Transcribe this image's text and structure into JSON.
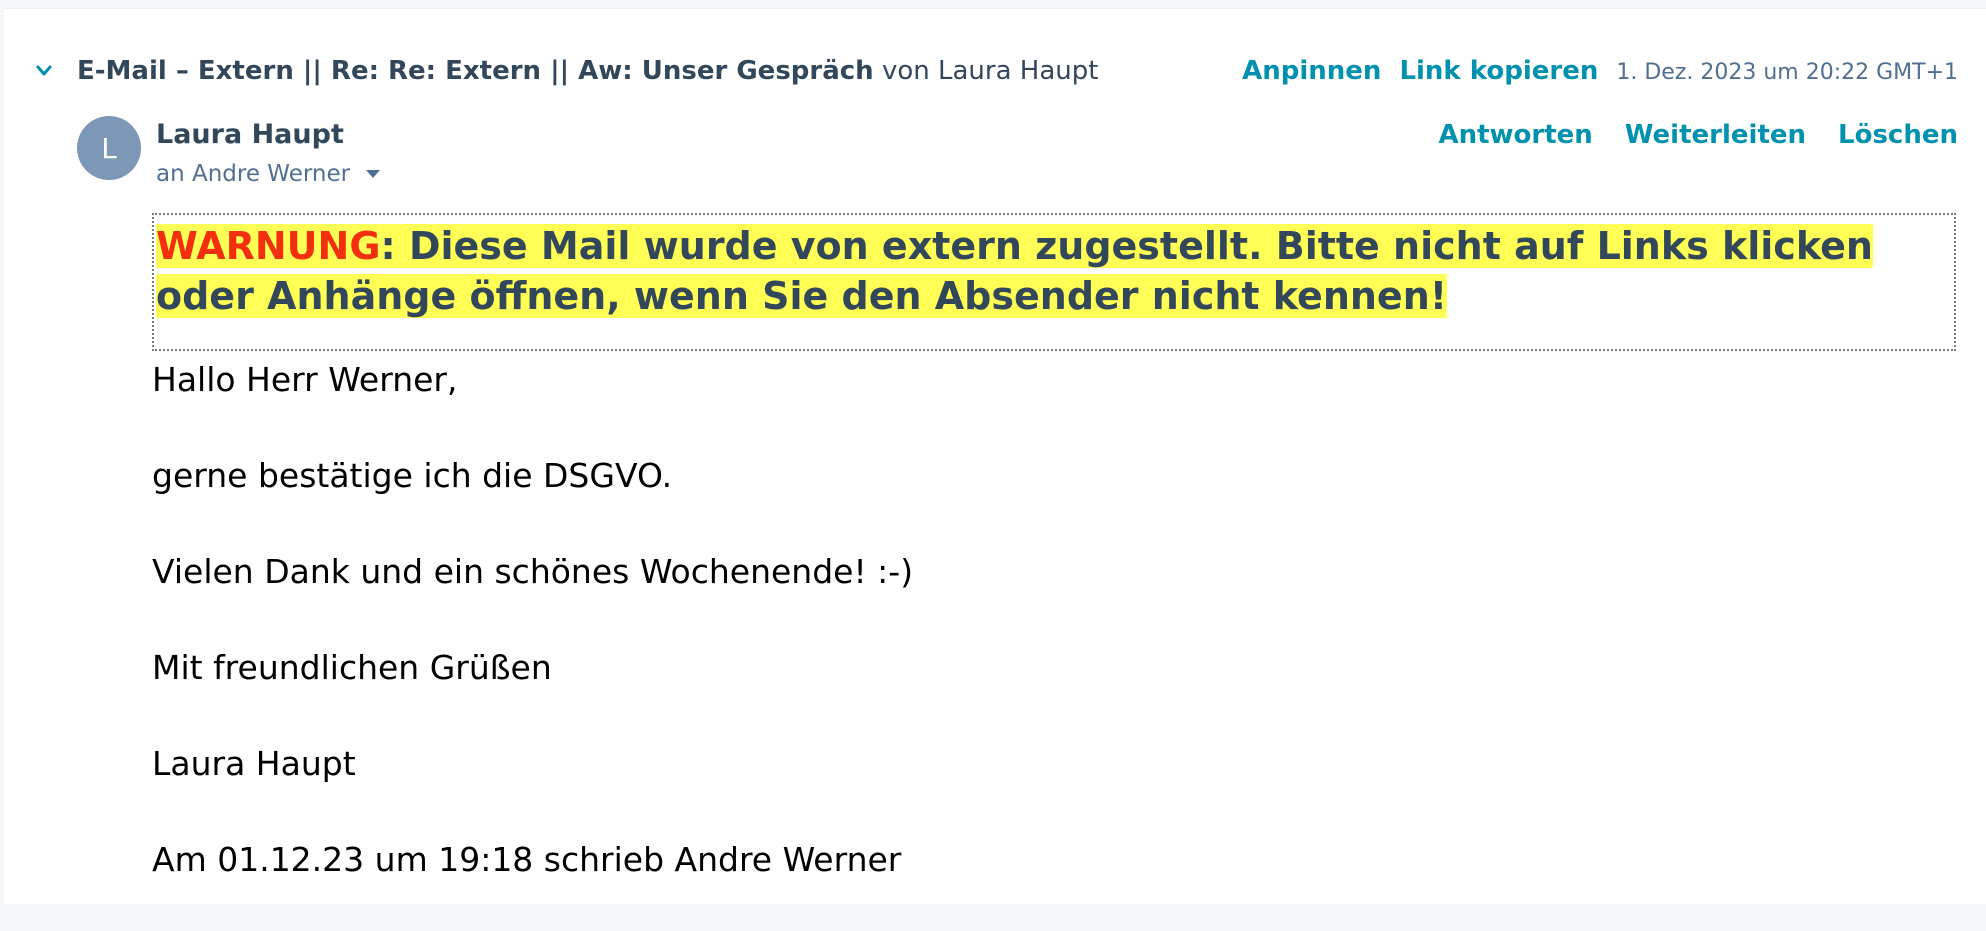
{
  "thread": {
    "subject": "E-Mail – Extern || Re: Re: Extern || Aw: Unser Gespräch",
    "from_label": " von Laura Haupt",
    "pin_label": "Anpinnen",
    "copy_link_label": "Link kopieren",
    "date": "1. Dez. 2023 um 20:22 GMT+1"
  },
  "message": {
    "avatar_initial": "L",
    "sender": "Laura Haupt",
    "recipient": "an Andre Werner",
    "reply_label": "Antworten",
    "forward_label": "Weiterleiten",
    "delete_label": "Löschen"
  },
  "warning": {
    "label": "WARNUNG",
    "text": ": Diese Mail wurde von extern zugestellt. Bitte nicht auf Links klicken oder Anhänge öffnen, wenn Sie den Absender nicht kennen!"
  },
  "body": {
    "lines": [
      "Hallo Herr Werner,",
      "gerne bestätige ich die DSGVO.",
      "Vielen Dank und ein schönes Wochenende! :-)",
      "Mit freundlichen Grüßen",
      "Laura Haupt",
      "Am 01.12.23 um 19:18 schrieb Andre Werner"
    ]
  },
  "colors": {
    "link": "#0091ae",
    "text": "#33475b",
    "warning_red": "#f2300f",
    "highlight": "#ffff55",
    "avatar": "#7c98b6"
  },
  "icons": {
    "collapse": "chevron-down-icon",
    "recipients": "caret-down-icon"
  }
}
